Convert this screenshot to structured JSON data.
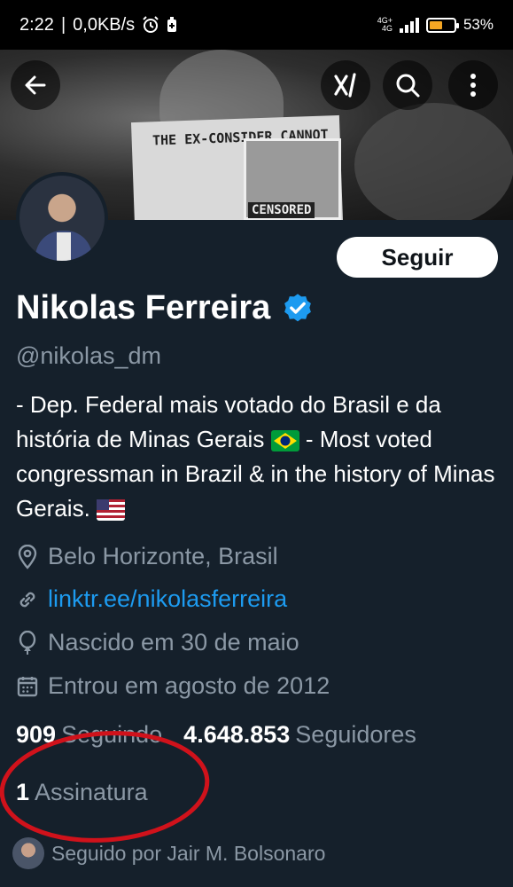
{
  "status_bar": {
    "time": "2:22",
    "net_speed": "0,0KB/s",
    "network_type_top": "4G+",
    "network_type_bottom": "4G",
    "battery": "53%",
    "battery_level": 0.53
  },
  "banner": {
    "sign_text": "THE EX-CONSIDER CANNOT",
    "censored_text": "CENSORED"
  },
  "header_actions": {
    "back": "arrow-left-icon",
    "grok": "grok-icon",
    "search": "search-icon",
    "more": "more-vertical-icon"
  },
  "profile": {
    "follow_label": "Seguir",
    "name": "Nikolas Ferreira",
    "verified": true,
    "verified_color": "#1d9bf0",
    "handle": "@nikolas_dm",
    "bio_part1": "- Dep. Federal mais votado do Brasil e da história de Minas Gerais",
    "bio_part2": "- Most voted congressman in Brazil & in the history of Minas Gerais.",
    "location": "Belo Horizonte, Brasil",
    "link": "linktr.ee/nikolasferreira",
    "birthday": "Nascido em 30 de maio",
    "joined": "Entrou em agosto de 2012"
  },
  "stats": {
    "following_count": "909",
    "following_label": "Seguindo",
    "followers_count": "4.648.853",
    "followers_label": "Seguidores",
    "subscriptions_count": "1",
    "subscriptions_label": "Assinatura"
  },
  "followed_by": "Seguido por Jair M. Bolsonaro",
  "colors": {
    "background": "#15202b",
    "muted_text": "#8b98a5",
    "link": "#1d9bf0",
    "annotation_circle": "#d0121b"
  }
}
